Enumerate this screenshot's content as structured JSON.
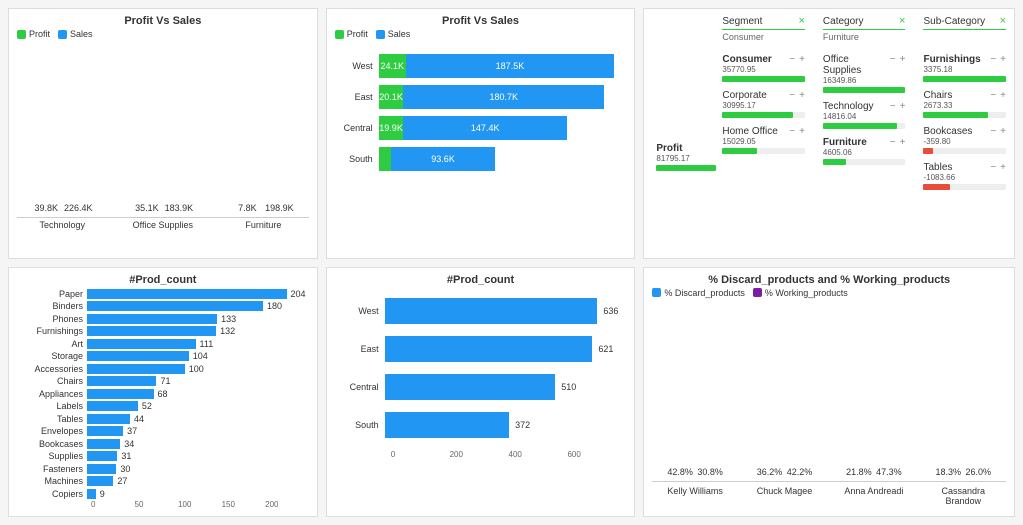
{
  "panel1": {
    "title": "Profit Vs Sales",
    "legend": {
      "a": "Profit",
      "b": "Sales"
    },
    "categories": [
      "Technology",
      "Office Supplies",
      "Furniture"
    ],
    "profit_labels": [
      "39.8K",
      "35.1K",
      "7.8K"
    ],
    "sales_labels": [
      "226.4K",
      "183.9K",
      "198.9K"
    ]
  },
  "panel2": {
    "title": "Profit Vs Sales",
    "legend": {
      "a": "Profit",
      "b": "Sales"
    },
    "rows": [
      {
        "cat": "West",
        "profit": "24.1K",
        "sales": "187.5K"
      },
      {
        "cat": "East",
        "profit": "20.1K",
        "sales": "180.7K"
      },
      {
        "cat": "Central",
        "profit": "19.9K",
        "sales": "147.4K"
      },
      {
        "cat": "South",
        "profit": "",
        "sales": "93.6K"
      }
    ]
  },
  "panel3": {
    "columns": {
      "segment": {
        "label": "Segment",
        "selected": "Consumer"
      },
      "category": {
        "label": "Category",
        "selected": "Furniture"
      },
      "subcat": {
        "label": "Sub-Category",
        "selected": ""
      }
    },
    "root": {
      "name": "Profit",
      "value": "81795.17"
    },
    "segments": [
      {
        "name": "Consumer",
        "value": "35770.95",
        "bold": true,
        "w": 100
      },
      {
        "name": "Corporate",
        "value": "30995.17",
        "w": 86
      },
      {
        "name": "Home Office",
        "value": "15029.05",
        "w": 42
      }
    ],
    "categories": [
      {
        "name": "Office Supplies",
        "value": "16349.86",
        "w": 100
      },
      {
        "name": "Technology",
        "value": "14816.04",
        "w": 90
      },
      {
        "name": "Furniture",
        "value": "4605.06",
        "w": 28,
        "bold": true
      }
    ],
    "subcats": [
      {
        "name": "Furnishings",
        "value": "3375.18",
        "w": 100,
        "bold": true
      },
      {
        "name": "Chairs",
        "value": "2673.33",
        "w": 78
      },
      {
        "name": "Bookcases",
        "value": "-359.80",
        "w": 12,
        "neg": true
      },
      {
        "name": "Tables",
        "value": "-1083.66",
        "w": 32,
        "neg": true
      }
    ]
  },
  "panel4": {
    "title": "#Prod_count",
    "rows": [
      {
        "cat": "Paper",
        "v": 204
      },
      {
        "cat": "Binders",
        "v": 180
      },
      {
        "cat": "Phones",
        "v": 133
      },
      {
        "cat": "Furnishings",
        "v": 132
      },
      {
        "cat": "Art",
        "v": 111
      },
      {
        "cat": "Storage",
        "v": 104
      },
      {
        "cat": "Accessories",
        "v": 100
      },
      {
        "cat": "Chairs",
        "v": 71
      },
      {
        "cat": "Appliances",
        "v": 68
      },
      {
        "cat": "Labels",
        "v": 52
      },
      {
        "cat": "Tables",
        "v": 44
      },
      {
        "cat": "Envelopes",
        "v": 37
      },
      {
        "cat": "Bookcases",
        "v": 34
      },
      {
        "cat": "Supplies",
        "v": 31
      },
      {
        "cat": "Fasteners",
        "v": 30
      },
      {
        "cat": "Machines",
        "v": 27
      },
      {
        "cat": "Copiers",
        "v": 9
      }
    ],
    "ticks": [
      "0",
      "50",
      "100",
      "150",
      "200"
    ]
  },
  "panel5": {
    "title": "#Prod_count",
    "rows": [
      {
        "cat": "West",
        "v": 636
      },
      {
        "cat": "East",
        "v": 621
      },
      {
        "cat": "Central",
        "v": 510
      },
      {
        "cat": "South",
        "v": 372
      }
    ],
    "ticks": [
      "0",
      "200",
      "400",
      "600"
    ]
  },
  "panel6": {
    "title": "% Discard_products and % Working_products",
    "legend": {
      "a": "% Discard_products",
      "b": "% Working_products"
    },
    "categories": [
      "Kelly Williams",
      "Chuck Magee",
      "Anna Andreadi",
      "Cassandra Brandow"
    ],
    "discard": [
      "42.8%",
      "36.2%",
      "21.8%",
      "18.3%"
    ],
    "working": [
      "30.8%",
      "42.2%",
      "47.3%",
      "26.0%"
    ]
  },
  "chart_data": [
    {
      "type": "bar",
      "title": "Profit Vs Sales",
      "categories": [
        "Technology",
        "Office Supplies",
        "Furniture"
      ],
      "series": [
        {
          "name": "Profit",
          "values": [
            39800,
            35100,
            7800
          ]
        },
        {
          "name": "Sales",
          "values": [
            226400,
            183900,
            198900
          ]
        }
      ],
      "ylim": [
        0,
        240000
      ]
    },
    {
      "type": "bar",
      "orientation": "horizontal-stacked",
      "title": "Profit Vs Sales",
      "categories": [
        "West",
        "East",
        "Central",
        "South"
      ],
      "series": [
        {
          "name": "Profit",
          "values": [
            24100,
            20100,
            19900,
            10000
          ]
        },
        {
          "name": "Sales",
          "values": [
            187500,
            180700,
            147400,
            93600
          ]
        }
      ]
    },
    {
      "type": "sankey",
      "root": {
        "name": "Profit",
        "value": 81795.17
      },
      "levels": [
        {
          "name": "Segment",
          "nodes": [
            {
              "name": "Consumer",
              "value": 35770.95
            },
            {
              "name": "Corporate",
              "value": 30995.17
            },
            {
              "name": "Home Office",
              "value": 15029.05
            }
          ]
        },
        {
          "name": "Category",
          "nodes": [
            {
              "name": "Office Supplies",
              "value": 16349.86
            },
            {
              "name": "Technology",
              "value": 14816.04
            },
            {
              "name": "Furniture",
              "value": 4605.06
            }
          ]
        },
        {
          "name": "Sub-Category",
          "nodes": [
            {
              "name": "Furnishings",
              "value": 3375.18
            },
            {
              "name": "Chairs",
              "value": 2673.33
            },
            {
              "name": "Bookcases",
              "value": -359.8
            },
            {
              "name": "Tables",
              "value": -1083.66
            }
          ]
        }
      ]
    },
    {
      "type": "bar",
      "orientation": "horizontal",
      "title": "#Prod_count",
      "categories": [
        "Paper",
        "Binders",
        "Phones",
        "Furnishings",
        "Art",
        "Storage",
        "Accessories",
        "Chairs",
        "Appliances",
        "Labels",
        "Tables",
        "Envelopes",
        "Bookcases",
        "Supplies",
        "Fasteners",
        "Machines",
        "Copiers"
      ],
      "values": [
        204,
        180,
        133,
        132,
        111,
        104,
        100,
        71,
        68,
        52,
        44,
        37,
        34,
        31,
        30,
        27,
        9
      ],
      "xlim": [
        0,
        210
      ]
    },
    {
      "type": "bar",
      "orientation": "horizontal",
      "title": "#Prod_count",
      "categories": [
        "West",
        "East",
        "Central",
        "South"
      ],
      "values": [
        636,
        621,
        510,
        372
      ],
      "xlim": [
        0,
        700
      ]
    },
    {
      "type": "bar",
      "title": "% Discard_products and % Working_products",
      "categories": [
        "Kelly Williams",
        "Chuck Magee",
        "Anna Andreadi",
        "Cassandra Brandow"
      ],
      "series": [
        {
          "name": "% Discard_products",
          "values": [
            42.8,
            36.2,
            21.8,
            18.3
          ]
        },
        {
          "name": "% Working_products",
          "values": [
            30.8,
            42.2,
            47.3,
            26.0
          ]
        }
      ],
      "ylim": [
        0,
        50
      ]
    }
  ]
}
